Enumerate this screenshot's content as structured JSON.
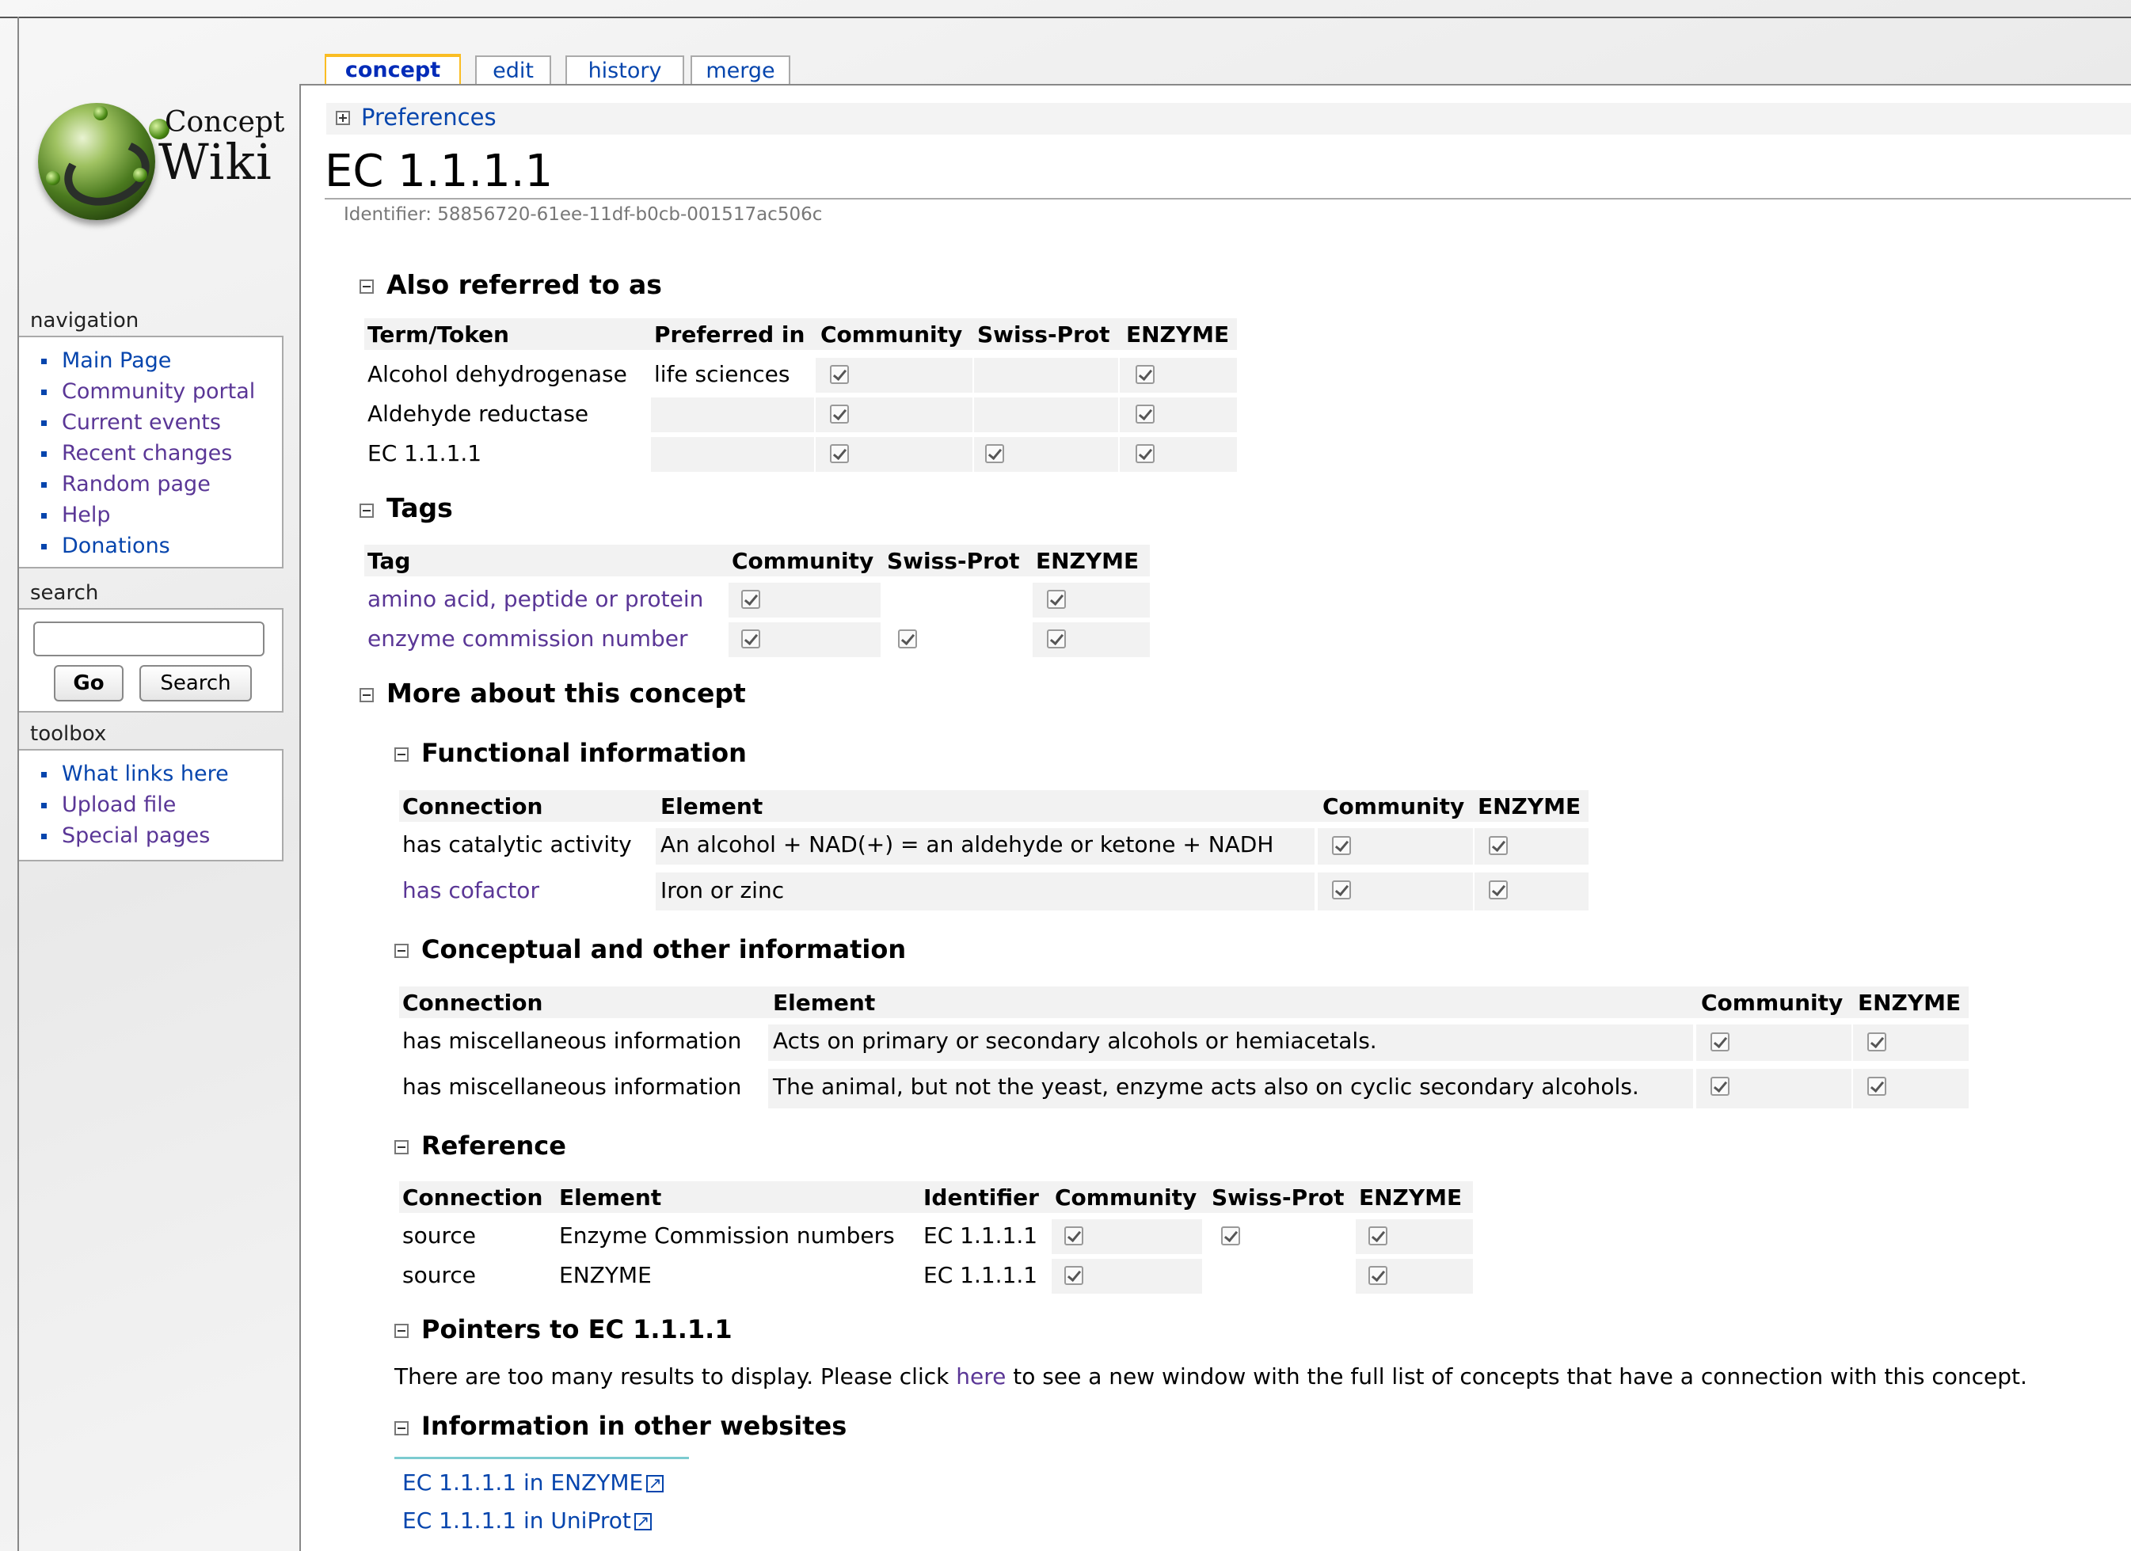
{
  "tabs": {
    "concept": "concept",
    "edit": "edit",
    "history": "history",
    "merge": "merge"
  },
  "logo": {
    "line1": "Concept",
    "line2": "Wiki"
  },
  "navigation": {
    "title": "navigation",
    "items": [
      "Main Page",
      "Community portal",
      "Current events",
      "Recent changes",
      "Random page",
      "Help",
      "Donations"
    ]
  },
  "search": {
    "title": "search",
    "value": "",
    "go_label": "Go",
    "search_label": "Search"
  },
  "toolbox": {
    "title": "toolbox",
    "items": [
      "What links here",
      "Upload file",
      "Special pages"
    ]
  },
  "preferences_label": "Preferences",
  "page_title": "EC 1.1.1.1",
  "identifier": "Identifier: 58856720-61ee-11df-b0cb-001517ac506c",
  "sections": {
    "also": {
      "title": "Also referred to as",
      "headers": [
        "Term/Token",
        "Preferred in",
        "Community",
        "Swiss-Prot",
        "ENZYME"
      ],
      "rows": [
        {
          "term": "Alcohol dehydrogenase",
          "preferred": "life sciences",
          "community": true,
          "swissprot": false,
          "enzyme": true
        },
        {
          "term": "Aldehyde reductase",
          "preferred": "",
          "community": true,
          "swissprot": false,
          "enzyme": true
        },
        {
          "term": "EC 1.1.1.1",
          "preferred": "",
          "community": true,
          "swissprot": true,
          "enzyme": true
        }
      ]
    },
    "tags": {
      "title": "Tags",
      "headers": [
        "Tag",
        "Community",
        "Swiss-Prot",
        "ENZYME"
      ],
      "rows": [
        {
          "tag": "amino acid, peptide or protein",
          "community": true,
          "swissprot": false,
          "enzyme": true
        },
        {
          "tag": "enzyme commission number",
          "community": true,
          "swissprot": true,
          "enzyme": true
        }
      ]
    },
    "more": {
      "title": "More about this concept"
    },
    "functional": {
      "title": "Functional information",
      "headers": [
        "Connection",
        "Element",
        "Community",
        "ENZYME"
      ],
      "rows": [
        {
          "connection": "has catalytic activity",
          "element": "An alcohol + NAD(+) = an aldehyde or ketone + NADH"
        },
        {
          "connection": "has cofactor",
          "element": "Iron or zinc"
        }
      ]
    },
    "conceptual": {
      "title": "Conceptual and other information",
      "headers": [
        "Connection",
        "Element",
        "Community",
        "ENZYME"
      ],
      "rows": [
        {
          "connection": "has miscellaneous information",
          "element": "Acts on primary or secondary alcohols or hemiacetals."
        },
        {
          "connection": "has miscellaneous information",
          "element": "The animal, but not the yeast, enzyme acts also on cyclic secondary alcohols."
        }
      ]
    },
    "reference": {
      "title": "Reference",
      "headers": [
        "Connection",
        "Element",
        "Identifier",
        "Community",
        "Swiss-Prot",
        "ENZYME"
      ],
      "rows": [
        {
          "connection": "source",
          "element": "Enzyme Commission numbers",
          "identifier": "EC 1.1.1.1",
          "swissprot": true
        },
        {
          "connection": "source",
          "element": "ENZYME",
          "identifier": "EC 1.1.1.1",
          "swissprot": false
        }
      ]
    },
    "pointers": {
      "title": "Pointers to EC 1.1.1.1",
      "text_before": "There are too many results to display. Please click",
      "link": "here",
      "text_after": "to see a new window with the full list of concepts that have a connection with this concept."
    },
    "websites": {
      "title": "Information in other websites",
      "links": [
        "EC 1.1.1.1 in ENZYME",
        "EC 1.1.1.1 in UniProt"
      ]
    }
  },
  "colors": {
    "link": "#0645ad",
    "visited": "#5a3696",
    "tab_accent": "#fabd23",
    "cell_bg": "#f2f2f2"
  }
}
